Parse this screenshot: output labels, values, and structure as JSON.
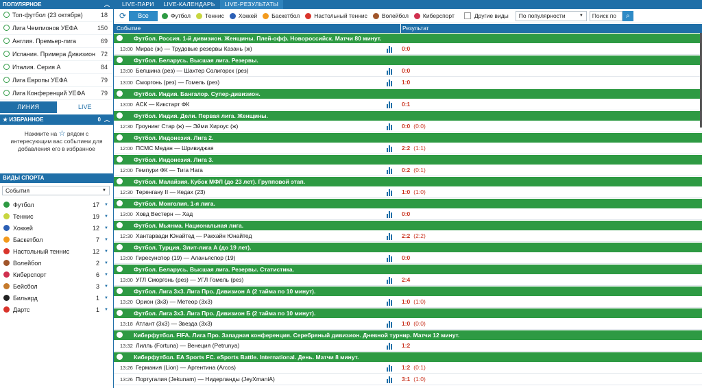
{
  "sidebar": {
    "popular_title": "ПОПУЛЯРНОЕ",
    "popular_items": [
      {
        "label": "Топ-футбол (23 октября)",
        "count": "18"
      },
      {
        "label": "Лига Чемпионов УЕФА",
        "count": "150"
      },
      {
        "label": "Англия. Премьер-лига",
        "count": "69"
      },
      {
        "label": "Испания. Примера Дивизион",
        "count": "72"
      },
      {
        "label": "Италия. Серия А",
        "count": "84"
      },
      {
        "label": "Лига Европы УЕФА",
        "count": "79"
      },
      {
        "label": "Лига Конференций УЕФА",
        "count": "79"
      }
    ],
    "tab_line": "ЛИНИЯ",
    "tab_live": "LIVE",
    "favorites_title": "ИЗБРАННОЕ",
    "favorites_count": "0",
    "favorites_text_1": "Нажмите на",
    "favorites_text_2": "рядом с интересующим вас событием для добавления его в избранное",
    "sports_title": "ВИДЫ СПОРТА",
    "sports_select": "События",
    "sports": [
      {
        "label": "Футбол",
        "count": "17",
        "color": "#2e9a43"
      },
      {
        "label": "Теннис",
        "count": "19",
        "color": "#c8d640"
      },
      {
        "label": "Хоккей",
        "count": "12",
        "color": "#2b5fb5"
      },
      {
        "label": "Баскетбол",
        "count": "7",
        "color": "#f39a1d"
      },
      {
        "label": "Настольный теннис",
        "count": "12",
        "color": "#d9342b"
      },
      {
        "label": "Волейбол",
        "count": "2",
        "color": "#a0552a"
      },
      {
        "label": "Киберспорт",
        "count": "6",
        "color": "#d0304f"
      },
      {
        "label": "Бейсбол",
        "count": "3",
        "color": "#c57a2c"
      },
      {
        "label": "Бильярд",
        "count": "1",
        "color": "#222222"
      },
      {
        "label": "Дартс",
        "count": "1",
        "color": "#d9342b"
      }
    ]
  },
  "top_tabs": [
    "LIVE-ПАРИ",
    "LIVE-КАЛЕНДАРЬ",
    "LIVE-РЕЗУЛЬТАТЫ"
  ],
  "filters": {
    "all": "Все",
    "sports": [
      {
        "label": "Футбол",
        "color": "#2e9a43"
      },
      {
        "label": "Теннис",
        "color": "#c8d640"
      },
      {
        "label": "Хоккей",
        "color": "#2b5fb5"
      },
      {
        "label": "Баскетбол",
        "color": "#f39a1d"
      },
      {
        "label": "Настольный теннис",
        "color": "#d9342b"
      },
      {
        "label": "Волейбол",
        "color": "#a0552a"
      },
      {
        "label": "Киберспорт",
        "color": "#d0304f"
      }
    ],
    "other": "Другие виды",
    "sort": "По популярности",
    "search_placeholder": "Поиск по"
  },
  "columns": {
    "event": "Событие",
    "result": "Результат"
  },
  "results": [
    {
      "league": "Футбол. Россия. 1-й дивизион. Женщины. Плей-офф. Новороссийск. Матчи 80 минут.",
      "matches": [
        {
          "time": "13:00",
          "name": "Мирас (ж) — Трудовые резервы Казань (ж)",
          "score": "0:0",
          "half": ""
        }
      ]
    },
    {
      "league": "Футбол. Беларусь. Высшая лига. Резервы.",
      "matches": [
        {
          "time": "13:00",
          "name": "Белшина (рез) — Шахтер Солигорск (рез)",
          "score": "0:0",
          "half": ""
        },
        {
          "time": "13:00",
          "name": "Сморгонь (рез) — Гомель (рез)",
          "score": "1:0",
          "half": ""
        }
      ]
    },
    {
      "league": "Футбол. Индия. Бангалор. Супер-дивизион.",
      "matches": [
        {
          "time": "13:00",
          "name": "АСК — Кикстарт ФК",
          "score": "0:1",
          "half": ""
        }
      ]
    },
    {
      "league": "Футбол. Индия. Дели. Первая лига. Женщины.",
      "matches": [
        {
          "time": "12:30",
          "name": "Гроунинг Стар (ж) — Эйми Хироус (ж)",
          "score": "0:0",
          "half": "(0:0)"
        }
      ]
    },
    {
      "league": "Футбол. Индонезия. Лига 2.",
      "matches": [
        {
          "time": "12:00",
          "name": "ПСМС Медан — Шривиджая",
          "score": "2:2",
          "half": "(1:1)"
        }
      ]
    },
    {
      "league": "Футбол. Индонезия. Лига 3.",
      "matches": [
        {
          "time": "12:00",
          "name": "Гемпури ФК — Тига Нага",
          "score": "0:2",
          "half": "(0:1)"
        }
      ]
    },
    {
      "league": "Футбол. Малайзия. Кубок МФЛ (до 23 лет). Групповой этап.",
      "matches": [
        {
          "time": "12:30",
          "name": "Теренгану II — Кедах (23)",
          "score": "1:0",
          "half": "(1:0)"
        }
      ]
    },
    {
      "league": "Футбол. Монголия. 1-я лига.",
      "matches": [
        {
          "time": "13:00",
          "name": "Ховд Вестерн — Хад",
          "score": "0:0",
          "half": ""
        }
      ]
    },
    {
      "league": "Футбол. Мьянма. Национальная лига.",
      "matches": [
        {
          "time": "12:30",
          "name": "Хантарвади Юнайтед — Ракхайн Юнайтед",
          "score": "2:2",
          "half": "(2:2)"
        }
      ]
    },
    {
      "league": "Футбол. Турция. Элит-лига А (до 19 лет).",
      "matches": [
        {
          "time": "13:00",
          "name": "Гиресунспор (19) — Аланьяспор (19)",
          "score": "0:0",
          "half": ""
        }
      ]
    },
    {
      "league": "Футбол. Беларусь. Высшая лига. Резервы. Статистика.",
      "matches": [
        {
          "time": "13:00",
          "name": "УГЛ Сморгонь (рез) — УГЛ Гомель (рез)",
          "score": "2:4",
          "half": ""
        }
      ]
    },
    {
      "league": "Футбол. Лига 3х3. Лига Про. Дивизион А (2 тайма по 10 минут).",
      "matches": [
        {
          "time": "13:20",
          "name": "Орион (3х3) — Метеор (3х3)",
          "score": "1:0",
          "half": "(1:0)"
        }
      ]
    },
    {
      "league": "Футбол. Лига 3х3. Лига Про. Дивизион Б (2 тайма по 10 минут).",
      "matches": [
        {
          "time": "13:18",
          "name": "Атлант (3х3) — Звезда (3х3)",
          "score": "1:0",
          "half": "(0:0)"
        }
      ]
    },
    {
      "league": "Киберфутбол. FIFA. Лига Про. Западная конференция. Серебряный дивизион. Дневной турнир. Матчи 12 минут.",
      "matches": [
        {
          "time": "13:32",
          "name": "Лилль (Fortuna) — Венеция (Petrunya)",
          "score": "1:2",
          "half": ""
        }
      ]
    },
    {
      "league": "Киберфутбол. EA Sports FC. eSports Battle. International. День. Матчи 8 минут.",
      "matches": [
        {
          "time": "13:26",
          "name": "Германия (Lion) — Аргентина (Arcos)",
          "score": "1:2",
          "half": "(0:1)"
        },
        {
          "time": "13:26",
          "name": "Португалия (Jekunam) — Нидерланды (JeyXmaniA)",
          "score": "3:1",
          "half": "(1:0)"
        }
      ]
    }
  ]
}
